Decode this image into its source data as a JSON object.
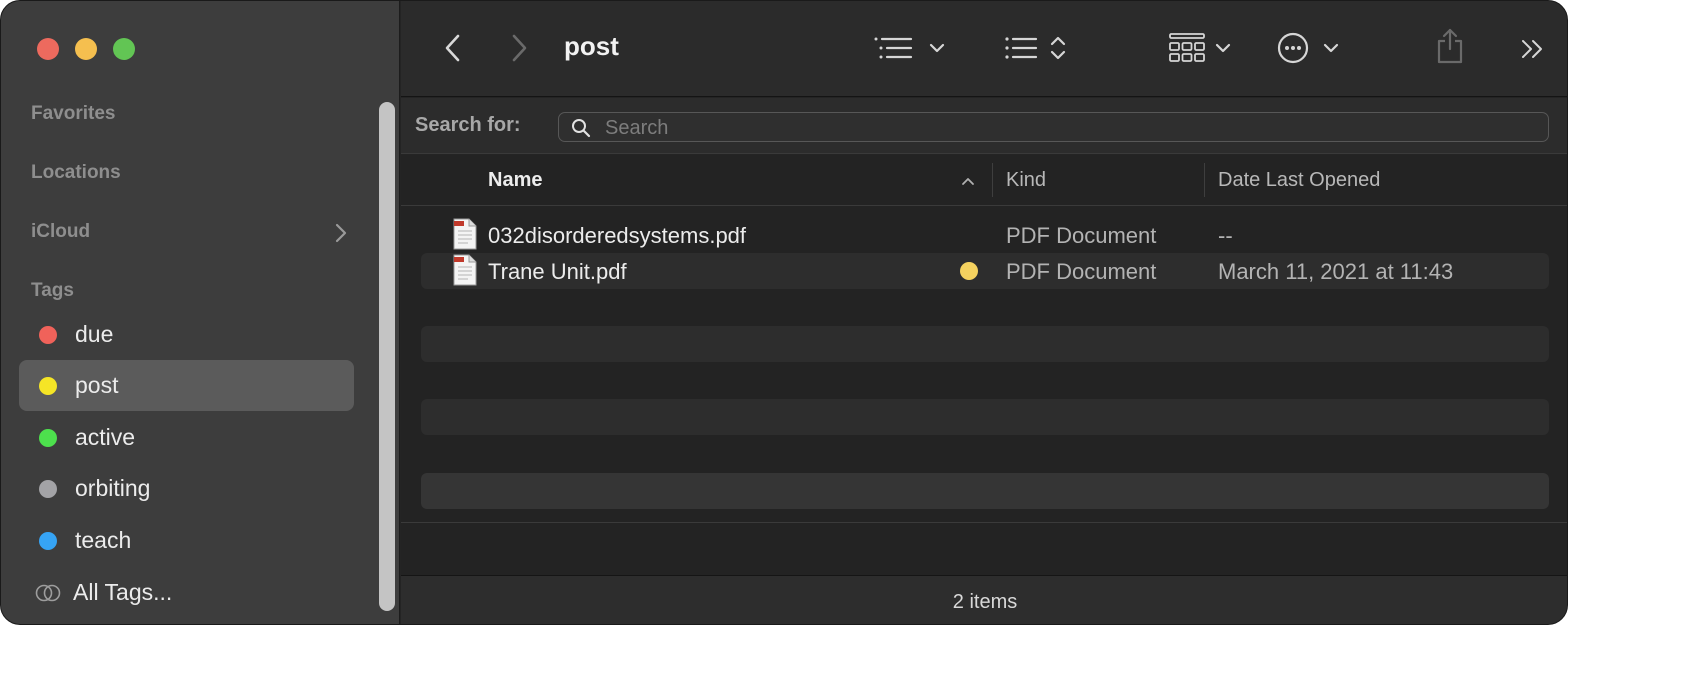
{
  "window": {
    "folder_title": "post"
  },
  "sidebar": {
    "sections": {
      "favorites": "Favorites",
      "locations": "Locations",
      "icloud": "iCloud",
      "tags": "Tags"
    },
    "tags": [
      {
        "label": "due",
        "color": "#f0625a",
        "selected": false
      },
      {
        "label": "post",
        "color": "#f5e526",
        "selected": true
      },
      {
        "label": "active",
        "color": "#4de04d",
        "selected": false
      },
      {
        "label": "orbiting",
        "color": "#a3a3a6",
        "selected": false
      },
      {
        "label": "teach",
        "color": "#36a4f5",
        "selected": false
      }
    ],
    "all_tags_label": "All Tags..."
  },
  "toolbar": {
    "icons": [
      "back-icon",
      "forward-icon",
      "list-view-icon",
      "group-icon",
      "gallery-view-icon",
      "more-actions-icon",
      "share-icon",
      "more-toolbar-icon"
    ]
  },
  "search": {
    "label": "Search for:",
    "placeholder": "Search",
    "value": ""
  },
  "columns": {
    "name": "Name",
    "kind": "Kind",
    "date": "Date Last Opened"
  },
  "files": [
    {
      "name": "032disorderedsystems.pdf",
      "kind": "PDF Document",
      "date": "--",
      "tag_color": ""
    },
    {
      "name": "Trane Unit.pdf",
      "kind": "PDF Document",
      "date": "March 11, 2021 at 11:43",
      "tag_color": "#f5d25f"
    }
  ],
  "status": {
    "item_count": "2 items"
  }
}
